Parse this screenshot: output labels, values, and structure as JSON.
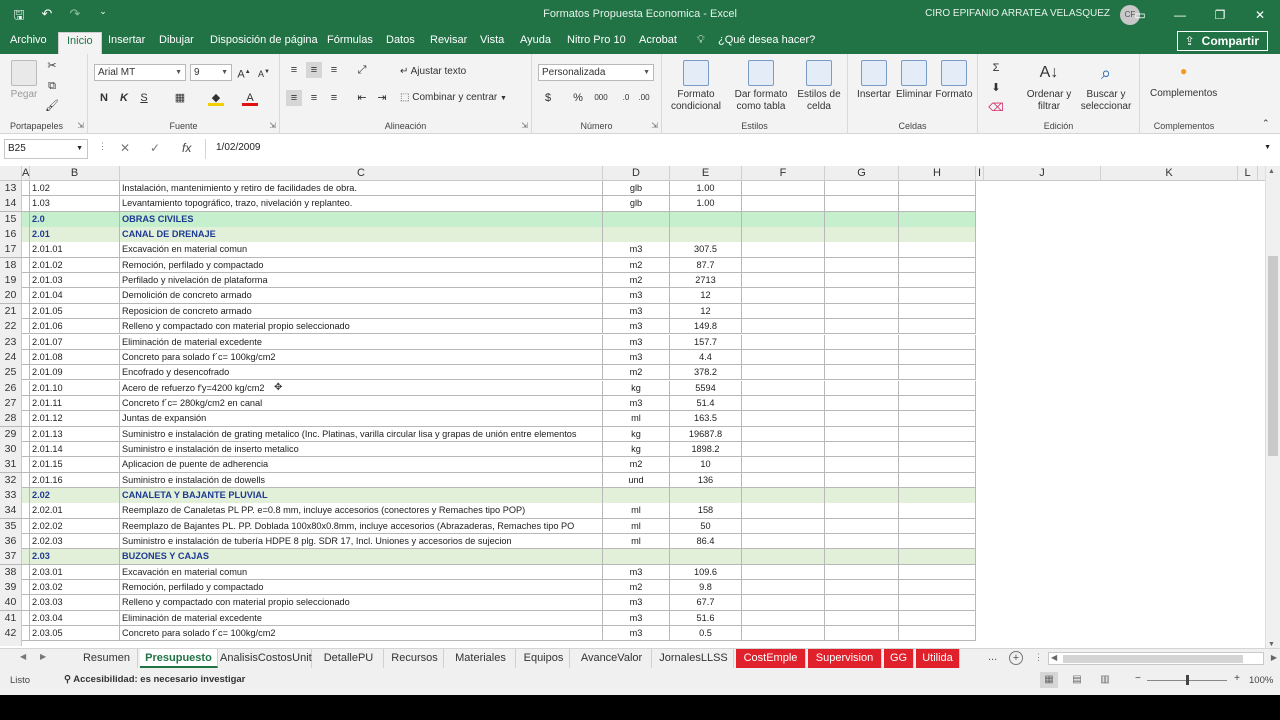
{
  "titlebar": {
    "doc_title": "Formatos Propuesta Economica  -  Excel",
    "user": "CIRO EPIFANIO ARRATEA VELASQUEZ",
    "avatar": "CF"
  },
  "menu": {
    "file": "Archivo",
    "tabs": [
      "Inicio",
      "Insertar",
      "Dibujar",
      "Disposición de página",
      "Fórmulas",
      "Datos",
      "Revisar",
      "Vista",
      "Ayuda",
      "Nitro Pro 10",
      "Acrobat"
    ],
    "tell_me": "¿Qué desea hacer?",
    "share": "Compartir"
  },
  "ribbon": {
    "clipboard": {
      "paste": "Pegar",
      "group": "Portapapeles"
    },
    "font": {
      "name": "Arial MT",
      "size": "9",
      "bold": "N",
      "italic": "K",
      "underline": "S",
      "group": "Fuente"
    },
    "alignment": {
      "wrap": "Ajustar texto",
      "merge": "Combinar y centrar",
      "group": "Alineación"
    },
    "number": {
      "format": "Personalizada",
      "percent": "%",
      "thousands": "000",
      "group": "Número"
    },
    "styles": {
      "conditional": "Formato condicional",
      "as_table": "Dar formato como tabla",
      "cell_styles": "Estilos de celda",
      "group": "Estilos"
    },
    "cells": {
      "insert": "Insertar",
      "delete": "Eliminar",
      "format": "Formato",
      "group": "Celdas"
    },
    "editing": {
      "sort": "Ordenar y filtrar",
      "find": "Buscar y seleccionar",
      "group": "Edición"
    },
    "addins": {
      "label": "Complementos",
      "group": "Complementos"
    }
  },
  "formula_bar": {
    "name_box": "B25",
    "fx": "fx",
    "value": "1/02/2009"
  },
  "columns": [
    "A",
    "B",
    "C",
    "D",
    "E",
    "F",
    "G",
    "H",
    "I",
    "J",
    "K",
    "L"
  ],
  "rows": [
    {
      "n": "13",
      "b": "1.02",
      "c": "Instalación, mantenimiento y retiro de facilidades de obra.",
      "d": "glb",
      "e": "1.00",
      "style": ""
    },
    {
      "n": "14",
      "b": "1.03",
      "c": "Levantamiento topográfico, trazo, nivelación y replanteo.",
      "d": "glb",
      "e": "1.00",
      "style": ""
    },
    {
      "n": "15",
      "b": "2.0",
      "c": "OBRAS CIVILES",
      "d": "",
      "e": "",
      "style": "main"
    },
    {
      "n": "16",
      "b": "2.01",
      "c": "CANAL DE DRENAJE",
      "d": "",
      "e": "",
      "style": "sec"
    },
    {
      "n": "17",
      "b": "2.01.01",
      "c": "Excavación en material comun",
      "d": "m3",
      "e": "307.5",
      "style": ""
    },
    {
      "n": "18",
      "b": "2.01.02",
      "c": "Remoción, perfilado y compactado",
      "d": "m2",
      "e": "87.7",
      "style": ""
    },
    {
      "n": "19",
      "b": "2.01.03",
      "c": "Perfilado y nivelación de plataforma",
      "d": "m2",
      "e": "2713",
      "style": ""
    },
    {
      "n": "20",
      "b": "2.01.04",
      "c": "Demolición de concreto armado",
      "d": "m3",
      "e": "12",
      "style": ""
    },
    {
      "n": "21",
      "b": "2.01.05",
      "c": "Reposicion de concreto armado",
      "d": "m3",
      "e": "12",
      "style": ""
    },
    {
      "n": "22",
      "b": "2.01.06",
      "c": "Relleno y compactado con material propio seleccionado",
      "d": "m3",
      "e": "149.8",
      "style": ""
    },
    {
      "n": "23",
      "b": "2.01.07",
      "c": "Eliminación de material excedente",
      "d": "m3",
      "e": "157.7",
      "style": ""
    },
    {
      "n": "24",
      "b": "2.01.08",
      "c": "Concreto para solado f´c= 100kg/cm2",
      "d": "m3",
      "e": "4.4",
      "style": ""
    },
    {
      "n": "25",
      "b": "2.01.09",
      "c": "Encofrado y desencofrado",
      "d": "m2",
      "e": "378.2",
      "style": ""
    },
    {
      "n": "26",
      "b": "2.01.10",
      "c": "Acero de refuerzo f'y=4200 kg/cm2",
      "d": "kg",
      "e": "5594",
      "style": ""
    },
    {
      "n": "27",
      "b": "2.01.11",
      "c": "Concreto f´c= 280kg/cm2 en canal",
      "d": "m3",
      "e": "51.4",
      "style": ""
    },
    {
      "n": "28",
      "b": "2.01.12",
      "c": "Juntas de expansión",
      "d": "ml",
      "e": "163.5",
      "style": ""
    },
    {
      "n": "29",
      "b": "2.01.13",
      "c": "Suministro e instalación de grating metalico (Inc. Platinas, varilla circular lisa y grapas de unión entre elementos",
      "d": "kg",
      "e": "19687.8",
      "style": ""
    },
    {
      "n": "30",
      "b": "2.01.14",
      "c": "Suministro e instalación de inserto metalico",
      "d": "kg",
      "e": "1898.2",
      "style": ""
    },
    {
      "n": "31",
      "b": "2.01.15",
      "c": "Aplicacion de puente de adherencia",
      "d": "m2",
      "e": "10",
      "style": ""
    },
    {
      "n": "32",
      "b": "2.01.16",
      "c": "Suministro e instalación de dowells",
      "d": "und",
      "e": "136",
      "style": ""
    },
    {
      "n": "33",
      "b": "2.02",
      "c": "CANALETA Y BAJANTE PLUVIAL",
      "d": "",
      "e": "",
      "style": "sec"
    },
    {
      "n": "34",
      "b": "2.02.01",
      "c": "Reemplazo de Canaletas PL PP. e=0.8 mm, incluye accesorios (conectores y Remaches tipo POP)",
      "d": "ml",
      "e": "158",
      "style": ""
    },
    {
      "n": "35",
      "b": "2.02.02",
      "c": "Reemplazo de Bajantes PL. PP. Doblada 100x80x0.8mm, incluye accesorios (Abrazaderas, Remaches tipo PO",
      "d": "ml",
      "e": "50",
      "style": ""
    },
    {
      "n": "36",
      "b": "2.02.03",
      "c": "Suministro e instalación de tubería HDPE 8 plg. SDR 17, Incl. Uniones y accesorios de sujecion",
      "d": "ml",
      "e": "86.4",
      "style": ""
    },
    {
      "n": "37",
      "b": "2.03",
      "c": "BUZONES Y CAJAS",
      "d": "",
      "e": "",
      "style": "sec"
    },
    {
      "n": "38",
      "b": "2.03.01",
      "c": "Excavación en material comun",
      "d": "m3",
      "e": "109.6",
      "style": ""
    },
    {
      "n": "39",
      "b": "2.03.02",
      "c": "Remoción, perfilado y compactado",
      "d": "m2",
      "e": "9.8",
      "style": ""
    },
    {
      "n": "40",
      "b": "2.03.03",
      "c": "Relleno y compactado con material propio seleccionado",
      "d": "m3",
      "e": "67.7",
      "style": ""
    },
    {
      "n": "41",
      "b": "2.03.04",
      "c": "Eliminación de material excedente",
      "d": "m3",
      "e": "51.6",
      "style": ""
    },
    {
      "n": "42",
      "b": "2.03.05",
      "c": "Concreto para solado f´c= 100kg/cm2",
      "d": "m3",
      "e": "0.5",
      "style": ""
    }
  ],
  "sheets": [
    {
      "name": "Resumen",
      "kind": ""
    },
    {
      "name": "Presupuesto",
      "kind": "active"
    },
    {
      "name": "AnalisisCostosUnit",
      "kind": ""
    },
    {
      "name": "DetallePU",
      "kind": ""
    },
    {
      "name": "Recursos",
      "kind": ""
    },
    {
      "name": "Materiales",
      "kind": ""
    },
    {
      "name": "Equipos",
      "kind": ""
    },
    {
      "name": "AvanceValor",
      "kind": ""
    },
    {
      "name": "JornalesLLSS",
      "kind": ""
    },
    {
      "name": "CostEmple",
      "kind": "red"
    },
    {
      "name": "Supervision",
      "kind": "red"
    },
    {
      "name": "GG",
      "kind": "red"
    },
    {
      "name": "Utilida",
      "kind": "red"
    }
  ],
  "sheet_more": "...",
  "status": {
    "ready": "Listo",
    "accessibility": "Accesibilidad: es necesario investigar",
    "zoom": "100%"
  },
  "colors": {
    "brand": "#217346",
    "section_fill": "#e2f0d9",
    "main_fill": "#c6efce",
    "red_tab": "#e0202b"
  }
}
